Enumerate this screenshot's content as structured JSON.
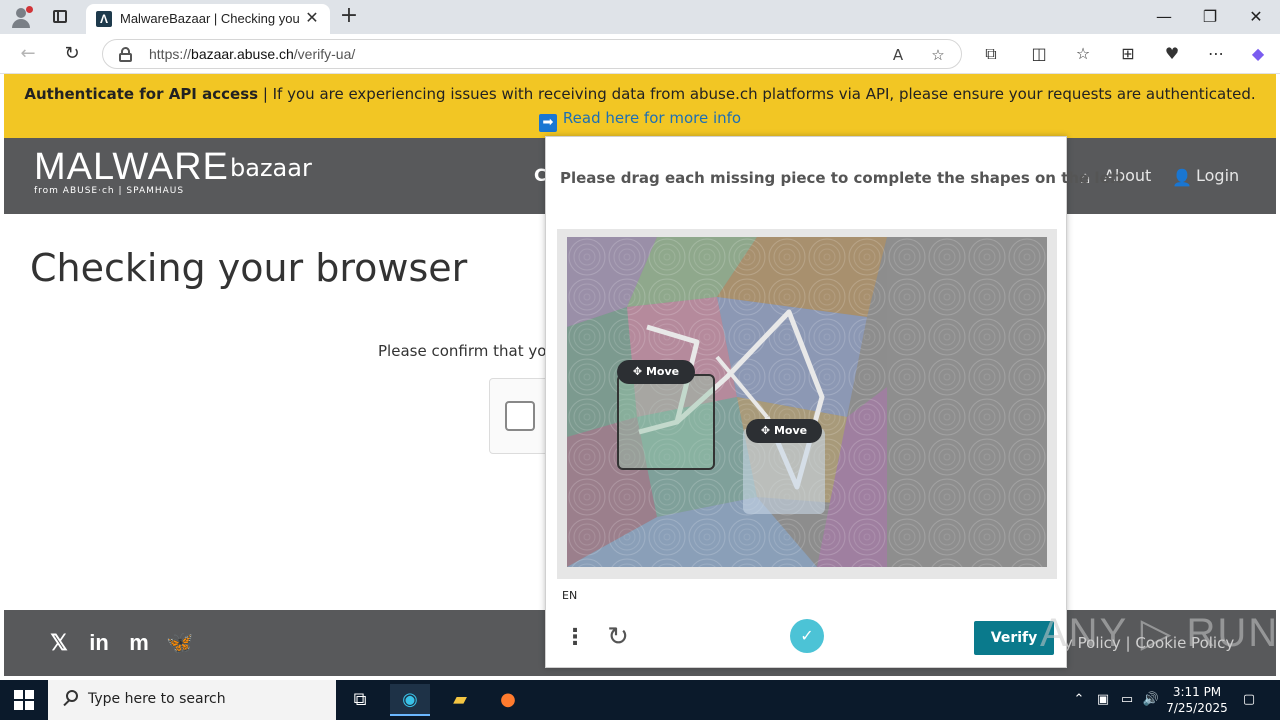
{
  "browser": {
    "tab_title": "MalwareBazaar | Checking your b",
    "tab_favicon": "Λ",
    "url_prefix": "https://",
    "url_host": "bazaar.abuse.ch",
    "url_path": "/verify-ua/"
  },
  "banner": {
    "bold": "Authenticate for API access",
    "text": " | If you are experiencing issues with receiving data from abuse.ch platforms via API, please ensure your requests are authenticated.",
    "link": "Read here for more info",
    "color": "#f2c624"
  },
  "header": {
    "logo_main": "MALWARE",
    "logo_sub": "bazaar",
    "logo_from": "from ABUSE·ch  |  SPAMHAUS",
    "nav_cut": "C",
    "about": "About",
    "login": "Login"
  },
  "main": {
    "heading": "Checking your browser",
    "confirm_text": "Please confirm that you"
  },
  "footer": {
    "links": "y Policy  |  Cookie Policy",
    "social": [
      "X",
      "in",
      "m",
      "bluesky"
    ]
  },
  "captcha": {
    "prompt": "Please drag each missing piece to complete the shapes on the left",
    "move_label_1": "Move",
    "move_label_2": "Move",
    "language": "EN",
    "verify_label": "Verify",
    "accent": "#0a7a8c"
  },
  "watermark": "ANY ▷ RUN",
  "taskbar": {
    "search_placeholder": "Type here to search",
    "time": "3:11 PM",
    "date": "7/25/2025"
  }
}
